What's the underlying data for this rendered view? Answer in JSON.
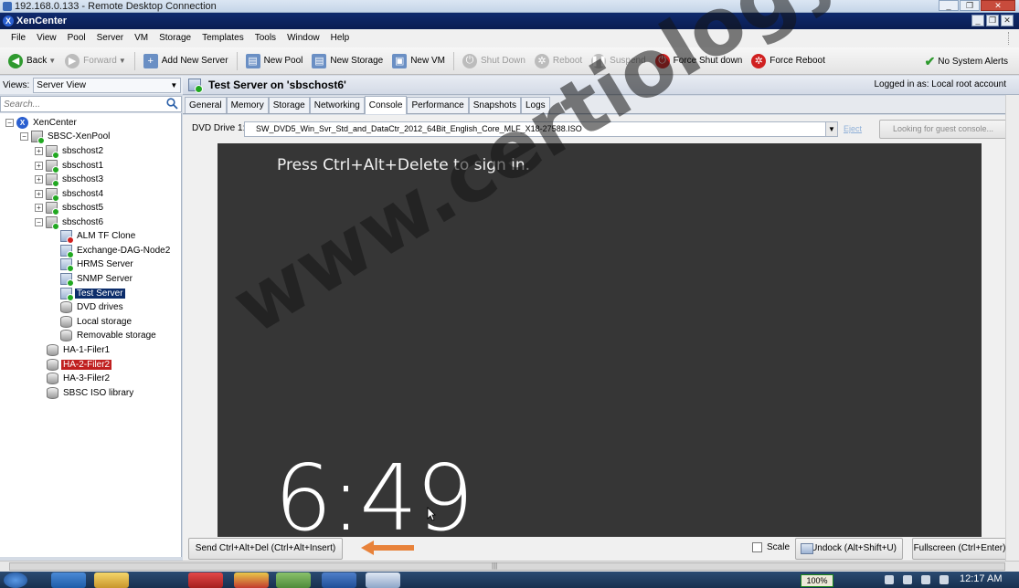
{
  "rdp_window": {
    "title": "192.168.0.133 - Remote Desktop Connection"
  },
  "app": {
    "title": "XenCenter"
  },
  "menu": [
    "File",
    "View",
    "Pool",
    "Server",
    "VM",
    "Storage",
    "Templates",
    "Tools",
    "Window",
    "Help"
  ],
  "toolbar": {
    "back": "Back",
    "forward": "Forward",
    "add_new_server": "Add New Server",
    "new_pool": "New Pool",
    "new_storage": "New Storage",
    "new_vm": "New VM",
    "shut_down": "Shut Down",
    "reboot": "Reboot",
    "suspend": "Suspend",
    "force_shut_down": "Force Shut down",
    "force_reboot": "Force Reboot",
    "system_alerts": "No System Alerts"
  },
  "views": {
    "label": "Views:",
    "selected": "Server View"
  },
  "search": {
    "placeholder": "Search..."
  },
  "tree": {
    "root": "XenCenter",
    "pool": "SBSC-XenPool",
    "hosts": [
      "sbschost2",
      "sbschost1",
      "sbschost3",
      "sbschost4",
      "sbschost5",
      "sbschost6"
    ],
    "vms": [
      "ALM TF Clone",
      "Exchange-DAG-Node2",
      "HRMS Server",
      "SNMP Server",
      "Test Server"
    ],
    "storage": [
      "DVD drives",
      "Local storage",
      "Removable storage"
    ],
    "other": [
      "HA-1-Filer1",
      "HA-2-Filer2",
      "HA-3-Filer2",
      "SBSC ISO library"
    ]
  },
  "header": {
    "title": "Test Server on 'sbschost6'",
    "logged_in": "Logged in as:  Local root account"
  },
  "tabs": [
    "General",
    "Memory",
    "Storage",
    "Networking",
    "Console",
    "Performance",
    "Snapshots",
    "Logs"
  ],
  "active_tab": "Console",
  "console": {
    "dvd_label": "DVD Drive 1:",
    "dvd_value": "SW_DVD5_Win_Svr_Std_and_DataCtr_2012_64Bit_English_Core_MLF_X18-27588.ISO",
    "eject": "Eject",
    "guest_console_btn": "Looking for guest console...",
    "prompt": "Press Ctrl+Alt+Delete to sign in.",
    "clock": "6:49",
    "watermark": "www.certiology.com"
  },
  "bottom": {
    "send_cad": "Send Ctrl+Alt+Del (Ctrl+Alt+Insert)",
    "scale": "Scale",
    "undock": "Undock (Alt+Shift+U)",
    "fullscreen": "Fullscreen (Ctrl+Enter)"
  },
  "taskbar": {
    "zoom": "100%",
    "time": "12:17 AM"
  },
  "colors": {
    "accent_arrow": "#e8823a",
    "xen_title": "#0f2a6d",
    "selected": "#0c2d6b",
    "alert": "#c02020"
  }
}
